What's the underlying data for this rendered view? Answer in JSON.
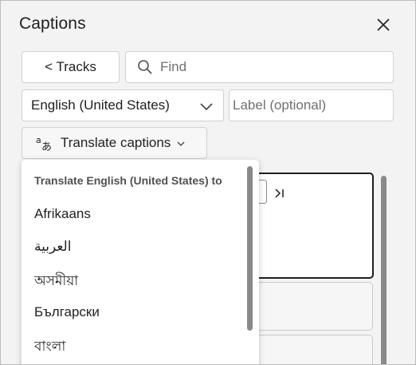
{
  "panel": {
    "title": "Captions"
  },
  "toolbar": {
    "tracks_label": "< Tracks",
    "find_placeholder": "Find",
    "language_selected": "English (United States)",
    "label_placeholder": "Label (optional)",
    "translate_label": "Translate captions"
  },
  "dropdown": {
    "header": "Translate English (United States) to",
    "items": [
      {
        "label": "Afrikaans"
      },
      {
        "label": "العربية"
      },
      {
        "label": "অসমীয়া"
      },
      {
        "label": "Български"
      },
      {
        "label": "বাংলা"
      }
    ]
  },
  "icons": {
    "close": "close-icon",
    "search": "search-icon",
    "chevron": "chevron-down-icon",
    "translate": "translate-icon",
    "skip": "skip-forward-icon"
  },
  "colors": {
    "panel_bg": "#f3f3f3",
    "text": "#1f1f1f",
    "placeholder": "#707070",
    "scrollbar": "#8a8a8a"
  }
}
